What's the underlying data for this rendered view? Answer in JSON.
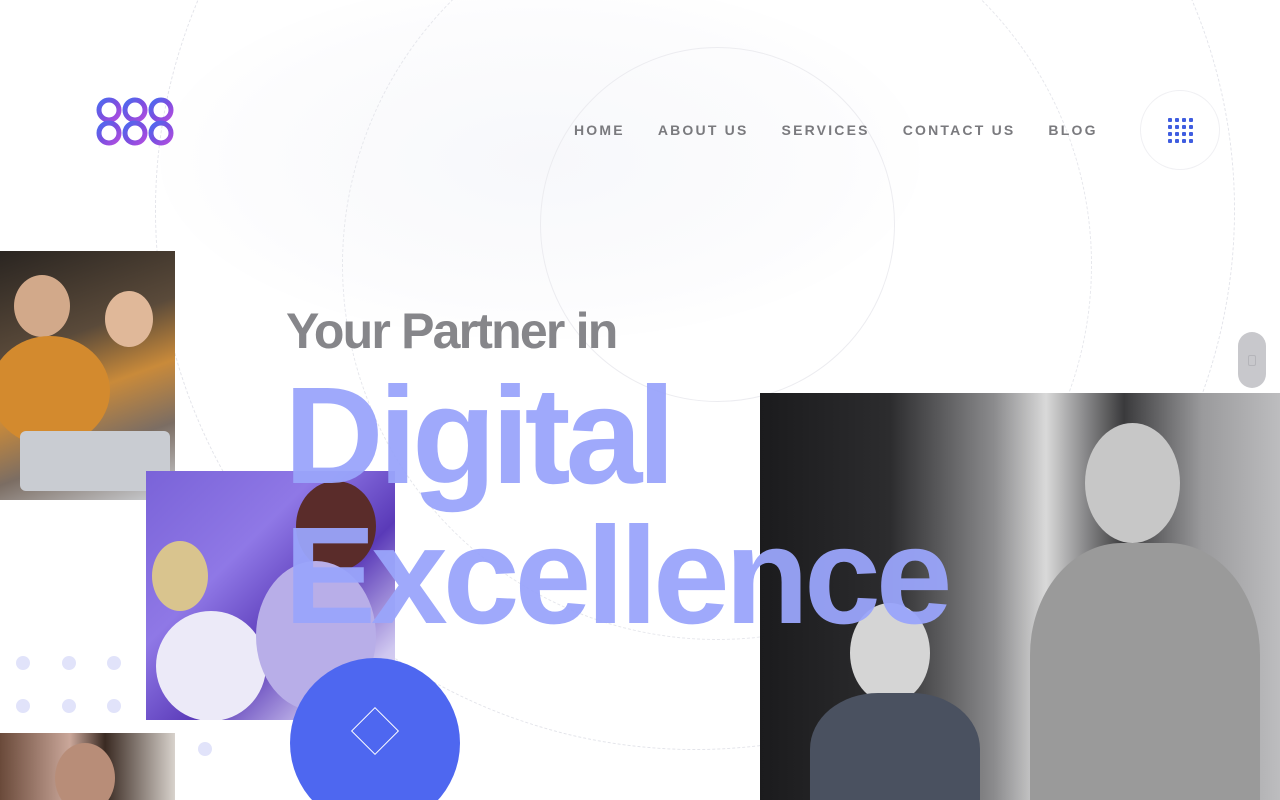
{
  "nav": {
    "items": [
      {
        "label": "HOME"
      },
      {
        "label": "ABOUT US"
      },
      {
        "label": "SERVICES"
      },
      {
        "label": "CONTACT US"
      },
      {
        "label": "BLOG"
      }
    ]
  },
  "hero": {
    "subtitle": "Your Partner in",
    "title_line1": "Digital",
    "title_line2": "Excellence"
  },
  "icons": {
    "logo": "infinity-rings-logo",
    "menu": "grid-menu-icon",
    "cta": "diamond-icon",
    "scroll": "scroll-icon"
  },
  "colors": {
    "accent": "#4e67f0",
    "hero_title": "#9aa5fb",
    "nav_text": "#7a7a7e",
    "dot": "#e1e3fa"
  }
}
